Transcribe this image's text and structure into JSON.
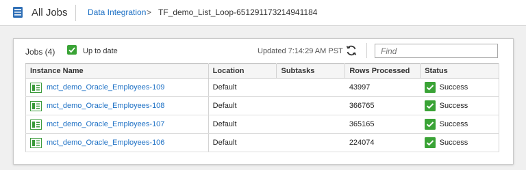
{
  "header": {
    "app_title": "All Jobs",
    "breadcrumb_link": "Data Integration",
    "breadcrumb_separator": ">",
    "breadcrumb_current": "TF_demo_List_Loop-651291173214941184"
  },
  "toolbar": {
    "jobs_count_label": "Jobs (4)",
    "up_to_date_label": "Up to date",
    "up_to_date_checked": true,
    "updated_label": "Updated 7:14:29 AM PST",
    "find_placeholder": "Find"
  },
  "table": {
    "columns": [
      "Instance Name",
      "Location",
      "Subtasks",
      "Rows Processed",
      "Status"
    ],
    "rows": [
      {
        "name": "mct_demo_Oracle_Employees-109",
        "location": "Default",
        "subtasks": "",
        "rows_processed": "43997",
        "status": "Success"
      },
      {
        "name": "mct_demo_Oracle_Employees-108",
        "location": "Default",
        "subtasks": "",
        "rows_processed": "366765",
        "status": "Success"
      },
      {
        "name": "mct_demo_Oracle_Employees-107",
        "location": "Default",
        "subtasks": "",
        "rows_processed": "365165",
        "status": "Success"
      },
      {
        "name": "mct_demo_Oracle_Employees-106",
        "location": "Default",
        "subtasks": "",
        "rows_processed": "224074",
        "status": "Success"
      }
    ]
  },
  "icons": {
    "app": "jobs-list-icon",
    "refresh": "refresh-icon",
    "job": "mapping-task-icon",
    "status": "success-check-icon"
  },
  "colors": {
    "link": "#1b6fc4",
    "success": "#3aa336",
    "job_icon": "#3a9a3a"
  }
}
